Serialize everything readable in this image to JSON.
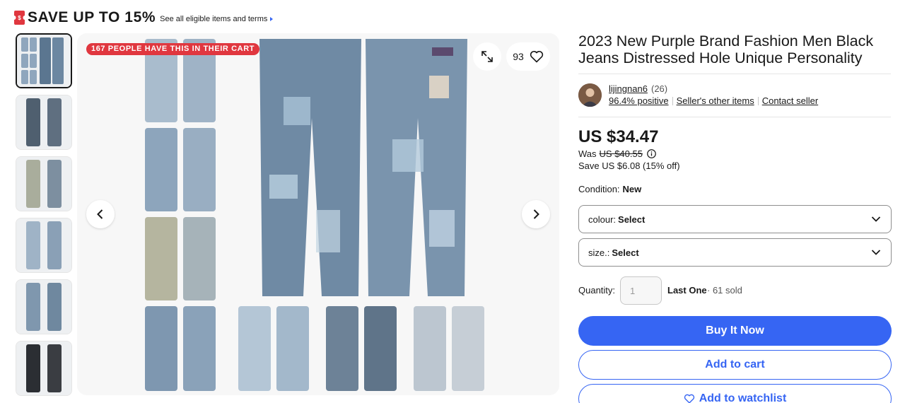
{
  "promo": {
    "headline": "SAVE UP TO 15%",
    "link": "See all eligible items and terms"
  },
  "gallery": {
    "cart_badge": "167 PEOPLE HAVE THIS IN THEIR CART",
    "watch_count": "93",
    "thumbnail_count": 6,
    "icons": [
      "expand-icon",
      "heart-icon",
      "chevron-left-icon",
      "chevron-right-icon"
    ]
  },
  "listing": {
    "title": "2023 New Purple Brand Fashion Men Black Jeans Distressed Hole Unique Personality"
  },
  "seller": {
    "name": "lijingnan6",
    "feedback_count": "(26)",
    "positive": "96.4% positive",
    "other_items": "Seller's other items",
    "contact": "Contact seller"
  },
  "pricing": {
    "price": "US $34.47",
    "was_label": "Was",
    "was_price": "US $40.55",
    "save": "Save US $6.08 (15% off)"
  },
  "condition": {
    "label": "Condition:",
    "value": "New"
  },
  "variations": {
    "colour": {
      "label": "colour:",
      "value": "Select"
    },
    "size": {
      "label": "size.:",
      "value": "Select"
    }
  },
  "quantity": {
    "label": "Quantity:",
    "placeholder": "1",
    "last_one": "Last One",
    "sold": "· 61 sold"
  },
  "actions": {
    "buy_now": "Buy It Now",
    "add_to_cart": "Add to cart",
    "add_to_watchlist": "Add to watchlist"
  },
  "colors": {
    "accent": "#3665f3",
    "badge": "#e0373f",
    "text": "#191919"
  }
}
